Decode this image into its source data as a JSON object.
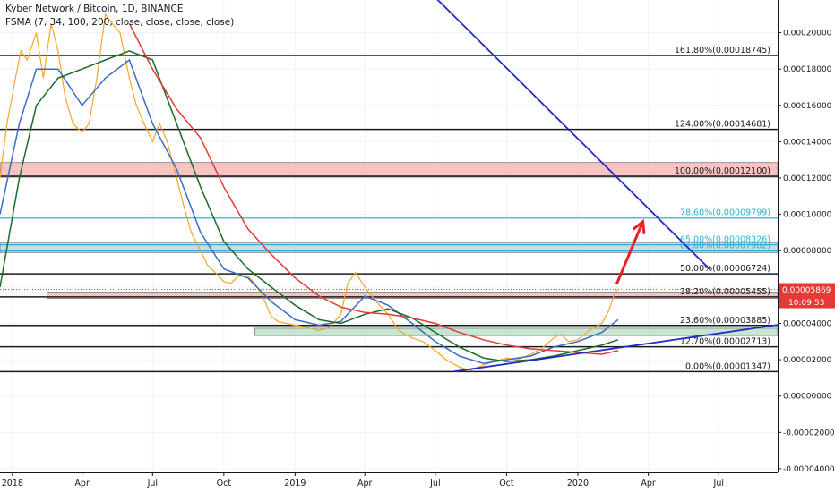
{
  "header": {
    "title": "Kyber Network / Bitcoin, 1D, BINANCE",
    "indicator": "FSMA (7, 34, 100, 200, close, close, close, close)"
  },
  "chart_data": {
    "type": "line",
    "y_axis": {
      "ticks": [
        "0.00020000",
        "0.00018000",
        "0.00016000",
        "0.00014000",
        "0.00012000",
        "0.00010000",
        "0.00008000",
        "0.00006000",
        "0.00004000",
        "0.00002000",
        "0.00000000",
        "-0.00002000",
        "-0.00004000"
      ],
      "tick_values": [
        0.0002,
        0.00018,
        0.00016,
        0.00014,
        0.00012,
        0.0001,
        8e-05,
        6e-05,
        4e-05,
        2e-05,
        0,
        -2e-05,
        -4e-05
      ],
      "range": [
        -4.2e-05,
        0.000218
      ]
    },
    "x_axis": {
      "ticks": [
        "2018",
        "Apr",
        "Jul",
        "Oct",
        "2019",
        "Apr",
        "Jul",
        "Oct",
        "2020",
        "Apr",
        "Jul"
      ],
      "tick_dates": [
        "2018-01-01",
        "2018-04-01",
        "2018-07-01",
        "2018-10-01",
        "2019-01-01",
        "2019-04-01",
        "2019-07-01",
        "2019-10-01",
        "2020-01-01",
        "2020-04-01",
        "2020-07-01"
      ],
      "range": [
        "2017-12-16",
        "2020-09-15"
      ]
    },
    "fib_levels": [
      {
        "label": "161.80%(0.00018745)",
        "value": 0.00018745
      },
      {
        "label": "124.00%(0.00014681)",
        "value": 0.00014681
      },
      {
        "label": "100.00%(0.00012100)",
        "value": 0.000121
      },
      {
        "label": "78.60%(0.00009799)",
        "value": 9.799e-05
      },
      {
        "label": "65.00%(0.00008326)",
        "value": 8.326e-05
      },
      {
        "label": "61.80%(0.00007982)",
        "value": 7.982e-05
      },
      {
        "label": "50.00%(0.00006724)",
        "value": 6.724e-05
      },
      {
        "label": "38.20%(0.00005455)",
        "value": 5.455e-05
      },
      {
        "label": "23.60%(0.00003885)",
        "value": 3.885e-05
      },
      {
        "label": "12.70%(0.00002713)",
        "value": 2.713e-05
      },
      {
        "label": "0.00%(0.00001347)",
        "value": 1.347e-05
      }
    ],
    "zones": [
      {
        "from": 0.0001205,
        "to": 0.0001285,
        "color": "#f5a3a3"
      },
      {
        "from": 5.38e-05,
        "to": 5.72e-05,
        "color": "#f5a3a3"
      },
      {
        "from": 3.33e-05,
        "to": 3.73e-05,
        "color": "#a8d8b8"
      },
      {
        "from": 7.9e-05,
        "to": 8.45e-05,
        "color": "#b9c4d8"
      }
    ],
    "price": {
      "label": "0.00005869",
      "value": 5.869e-05,
      "countdown": "10:09:53"
    },
    "series": [
      {
        "color": "#f5a623",
        "points": [
          [
            "2017-12-16",
            0.00012
          ],
          [
            "2017-12-25",
            0.00015
          ],
          [
            "2018-01-05",
            0.000175
          ],
          [
            "2018-01-12",
            0.00019
          ],
          [
            "2018-01-20",
            0.000185
          ],
          [
            "2018-02-01",
            0.0002
          ],
          [
            "2018-02-10",
            0.000175
          ],
          [
            "2018-02-20",
            0.000205
          ],
          [
            "2018-03-01",
            0.00019
          ],
          [
            "2018-03-10",
            0.000165
          ],
          [
            "2018-03-20",
            0.00015
          ],
          [
            "2018-04-01",
            0.000145
          ],
          [
            "2018-04-10",
            0.00015
          ],
          [
            "2018-04-20",
            0.000175
          ],
          [
            "2018-05-01",
            0.00021
          ],
          [
            "2018-05-10",
            0.000205
          ],
          [
            "2018-05-20",
            0.0002
          ],
          [
            "2018-06-01",
            0.000175
          ],
          [
            "2018-06-10",
            0.00016
          ],
          [
            "2018-06-20",
            0.00015
          ],
          [
            "2018-07-01",
            0.00014
          ],
          [
            "2018-07-10",
            0.00015
          ],
          [
            "2018-07-20",
            0.00014
          ],
          [
            "2018-08-01",
            0.00012
          ],
          [
            "2018-08-10",
            0.000105
          ],
          [
            "2018-08-20",
            9e-05
          ],
          [
            "2018-09-01",
            8e-05
          ],
          [
            "2018-09-10",
            7.2e-05
          ],
          [
            "2018-09-20",
            6.8e-05
          ],
          [
            "2018-10-01",
            6.3e-05
          ],
          [
            "2018-10-10",
            6.2e-05
          ],
          [
            "2018-10-20",
            6.6e-05
          ],
          [
            "2018-11-01",
            6.6e-05
          ],
          [
            "2018-11-10",
            6.2e-05
          ],
          [
            "2018-11-20",
            5.5e-05
          ],
          [
            "2018-12-01",
            4.4e-05
          ],
          [
            "2018-12-10",
            4.1e-05
          ],
          [
            "2018-12-20",
            4e-05
          ],
          [
            "2019-01-01",
            3.9e-05
          ],
          [
            "2019-01-15",
            3.8e-05
          ],
          [
            "2019-02-01",
            3.6e-05
          ],
          [
            "2019-02-15",
            3.8e-05
          ],
          [
            "2019-03-01",
            4.5e-05
          ],
          [
            "2019-03-10",
            6.2e-05
          ],
          [
            "2019-03-20",
            6.8e-05
          ],
          [
            "2019-04-01",
            6e-05
          ],
          [
            "2019-04-10",
            5.5e-05
          ],
          [
            "2019-04-20",
            5e-05
          ],
          [
            "2019-05-01",
            4.5e-05
          ],
          [
            "2019-05-15",
            3.6e-05
          ],
          [
            "2019-06-01",
            3.2e-05
          ],
          [
            "2019-06-15",
            3e-05
          ],
          [
            "2019-07-01",
            2.5e-05
          ],
          [
            "2019-07-15",
            2e-05
          ],
          [
            "2019-08-01",
            1.6e-05
          ],
          [
            "2019-08-15",
            1.4e-05
          ],
          [
            "2019-09-01",
            1.7e-05
          ],
          [
            "2019-09-15",
            1.9e-05
          ],
          [
            "2019-10-01",
            2.1e-05
          ],
          [
            "2019-10-15",
            2e-05
          ],
          [
            "2019-11-01",
            2.3e-05
          ],
          [
            "2019-11-15",
            2.6e-05
          ],
          [
            "2019-12-01",
            3.2e-05
          ],
          [
            "2019-12-10",
            3.4e-05
          ],
          [
            "2019-12-20",
            3e-05
          ],
          [
            "2020-01-01",
            3.1e-05
          ],
          [
            "2020-01-15",
            3.6e-05
          ],
          [
            "2020-02-01",
            4e-05
          ],
          [
            "2020-02-10",
            4.7e-05
          ],
          [
            "2020-02-18",
            5.7e-05
          ],
          [
            "2020-02-22",
            5.87e-05
          ]
        ]
      },
      {
        "color": "#3b6cc2",
        "points": [
          [
            "2017-12-16",
            0.0001
          ],
          [
            "2018-01-10",
            0.00015
          ],
          [
            "2018-02-01",
            0.00018
          ],
          [
            "2018-03-01",
            0.00018
          ],
          [
            "2018-04-01",
            0.00016
          ],
          [
            "2018-05-01",
            0.000175
          ],
          [
            "2018-06-01",
            0.000185
          ],
          [
            "2018-07-01",
            0.00015
          ],
          [
            "2018-08-01",
            0.000125
          ],
          [
            "2018-09-01",
            9e-05
          ],
          [
            "2018-10-01",
            7e-05
          ],
          [
            "2018-11-01",
            6.5e-05
          ],
          [
            "2018-12-01",
            5.2e-05
          ],
          [
            "2019-01-01",
            4.2e-05
          ],
          [
            "2019-02-01",
            3.9e-05
          ],
          [
            "2019-03-01",
            4.1e-05
          ],
          [
            "2019-04-01",
            5.5e-05
          ],
          [
            "2019-05-01",
            5e-05
          ],
          [
            "2019-06-01",
            4e-05
          ],
          [
            "2019-07-01",
            3e-05
          ],
          [
            "2019-08-01",
            2.2e-05
          ],
          [
            "2019-09-01",
            1.8e-05
          ],
          [
            "2019-10-01",
            2e-05
          ],
          [
            "2019-11-01",
            2.2e-05
          ],
          [
            "2019-12-01",
            2.7e-05
          ],
          [
            "2020-01-01",
            3e-05
          ],
          [
            "2020-02-01",
            3.5e-05
          ],
          [
            "2020-02-22",
            4.2e-05
          ]
        ]
      },
      {
        "color": "#1a6b2a",
        "points": [
          [
            "2017-12-16",
            6e-05
          ],
          [
            "2018-01-10",
            0.00012
          ],
          [
            "2018-02-01",
            0.00016
          ],
          [
            "2018-03-01",
            0.000175
          ],
          [
            "2018-04-01",
            0.00018
          ],
          [
            "2018-05-01",
            0.000185
          ],
          [
            "2018-06-01",
            0.00019
          ],
          [
            "2018-07-01",
            0.000185
          ],
          [
            "2018-08-01",
            0.00015
          ],
          [
            "2018-09-01",
            0.000115
          ],
          [
            "2018-10-01",
            8.5e-05
          ],
          [
            "2018-11-01",
            7e-05
          ],
          [
            "2018-12-01",
            6e-05
          ],
          [
            "2019-01-01",
            5e-05
          ],
          [
            "2019-02-01",
            4.2e-05
          ],
          [
            "2019-03-01",
            4e-05
          ],
          [
            "2019-04-01",
            4.5e-05
          ],
          [
            "2019-05-01",
            4.8e-05
          ],
          [
            "2019-06-01",
            4.3e-05
          ],
          [
            "2019-07-01",
            3.5e-05
          ],
          [
            "2019-08-01",
            2.7e-05
          ],
          [
            "2019-09-01",
            2.1e-05
          ],
          [
            "2019-10-01",
            1.9e-05
          ],
          [
            "2019-11-01",
            2e-05
          ],
          [
            "2019-12-01",
            2.2e-05
          ],
          [
            "2020-01-01",
            2.5e-05
          ],
          [
            "2020-02-01",
            2.8e-05
          ],
          [
            "2020-02-22",
            3.1e-05
          ]
        ]
      },
      {
        "color": "#e53935",
        "points": [
          [
            "2018-06-01",
            0.000205
          ],
          [
            "2018-07-01",
            0.00018
          ],
          [
            "2018-08-01",
            0.000158
          ],
          [
            "2018-09-01",
            0.000142
          ],
          [
            "2018-10-01",
            0.000115
          ],
          [
            "2018-11-01",
            9.2e-05
          ],
          [
            "2018-12-01",
            7.8e-05
          ],
          [
            "2019-01-01",
            6.5e-05
          ],
          [
            "2019-02-01",
            5.5e-05
          ],
          [
            "2019-03-01",
            4.9e-05
          ],
          [
            "2019-04-01",
            4.6e-05
          ],
          [
            "2019-05-01",
            4.5e-05
          ],
          [
            "2019-06-01",
            4.3e-05
          ],
          [
            "2019-07-01",
            4e-05
          ],
          [
            "2019-08-01",
            3.5e-05
          ],
          [
            "2019-09-01",
            3.1e-05
          ],
          [
            "2019-10-01",
            2.8e-05
          ],
          [
            "2019-11-01",
            2.6e-05
          ],
          [
            "2019-12-01",
            2.5e-05
          ],
          [
            "2020-01-01",
            2.4e-05
          ],
          [
            "2020-02-01",
            2.3e-05
          ],
          [
            "2020-02-22",
            2.5e-05
          ]
        ]
      }
    ],
    "trendlines": [
      {
        "color": "#1f2bc4",
        "from": [
          "2019-07-25",
          1.35e-05
        ],
        "to": [
          "2020-09-15",
          3.92e-05
        ]
      },
      {
        "color": "#1f2bc4",
        "from": [
          "2019-05-25",
          0.000235
        ],
        "to": [
          "2020-06-20",
          6.95e-05
        ]
      }
    ],
    "arrow": {
      "color": "#e8202a",
      "from": [
        "2020-02-20",
        6.15e-05
      ],
      "to": [
        "2020-03-25",
        9.6e-05
      ]
    }
  }
}
